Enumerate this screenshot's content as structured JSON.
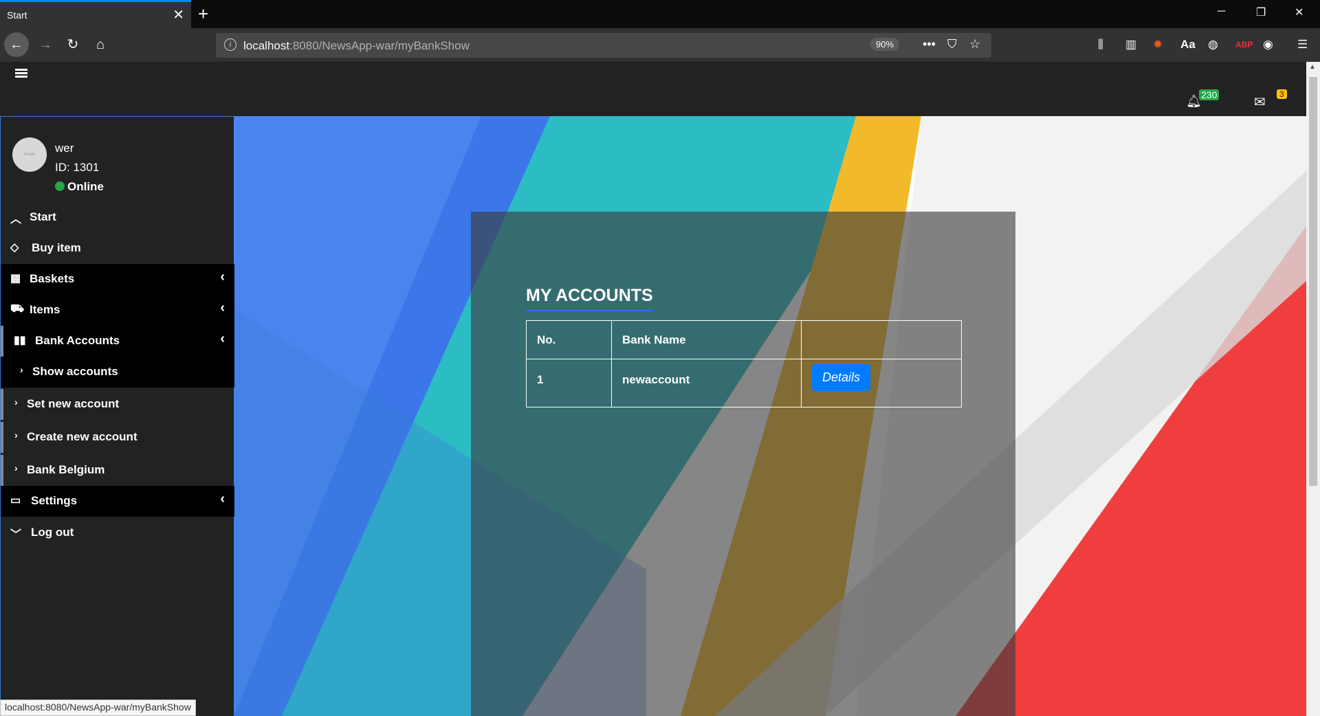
{
  "browser": {
    "tab_title": "Start",
    "tab_close": "✕",
    "new_tab": "+",
    "url_host": "localhost",
    "url_path": ":8080/NewsApp-war/myBankShow",
    "zoom": "90%",
    "window_controls": [
      "─",
      "❐",
      "✕"
    ],
    "status_url": "localhost:8080/NewsApp-war/myBankShow"
  },
  "header": {
    "notifications_count": "230",
    "messages_count": "3"
  },
  "user": {
    "avatar_text": "image",
    "name": "wer",
    "id": "ID: 1301",
    "status": "Online"
  },
  "sidebar": {
    "items": [
      {
        "label": "Start",
        "icon": "chevron-up-icon"
      },
      {
        "label": "Buy item",
        "icon": "diamond-icon"
      },
      {
        "label": "Baskets",
        "icon": "grid-icon"
      },
      {
        "label": "Items",
        "icon": "cart-icon"
      },
      {
        "label": "Bank Accounts",
        "icon": "bar-chart-icon"
      },
      {
        "label": "Settings",
        "icon": "laptop-icon"
      },
      {
        "label": "Log out",
        "icon": "chevron-down-icon"
      }
    ],
    "bank_submenu": [
      {
        "label": "Show accounts"
      },
      {
        "label": "Set new account"
      },
      {
        "label": "Create new account"
      },
      {
        "label": "Bank Belgium"
      }
    ]
  },
  "main": {
    "title": "MY ACCOUNTS",
    "table": {
      "headers": [
        "No.",
        "Bank Name",
        ""
      ],
      "rows": [
        {
          "no": "1",
          "bank_name": "newaccount",
          "action": "Details"
        }
      ]
    }
  },
  "colors": {
    "accent": "#007bff",
    "online": "#28a745",
    "notification_badge": "#28a745",
    "message_badge": "#ffc107",
    "panel_underline": "#2a6ee6"
  }
}
